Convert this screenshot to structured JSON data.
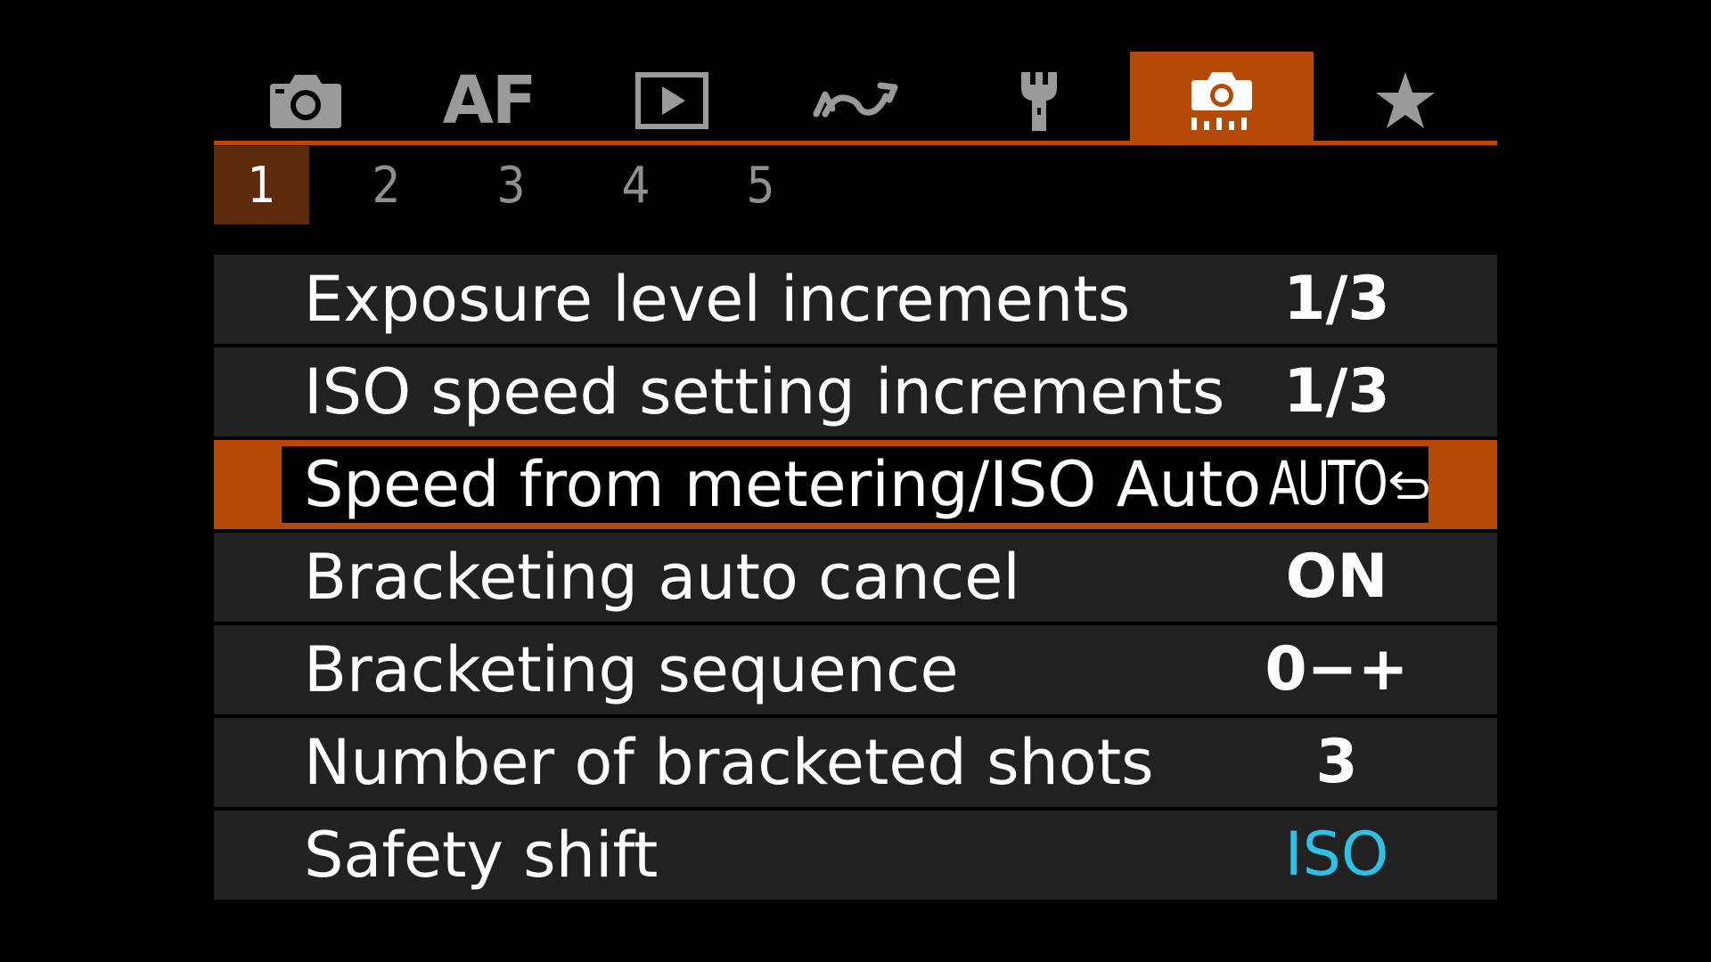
{
  "colors": {
    "accent": "#b44a06",
    "icon_gray": "#9a9a9a",
    "row_bg": "#212121",
    "value_blue": "#2cc2e8"
  },
  "tabs": [
    {
      "icon": "camera-icon",
      "active": false
    },
    {
      "label": "AF",
      "active": false
    },
    {
      "icon": "playback-icon",
      "active": false
    },
    {
      "icon": "wireless-icon",
      "active": false
    },
    {
      "icon": "wrench-icon",
      "active": false
    },
    {
      "icon": "custom-functions-icon",
      "active": true
    },
    {
      "icon": "star-icon",
      "active": false
    }
  ],
  "subtabs": [
    {
      "label": "1",
      "active": true
    },
    {
      "label": "2",
      "active": false
    },
    {
      "label": "3",
      "active": false
    },
    {
      "label": "4",
      "active": false
    },
    {
      "label": "5",
      "active": false
    }
  ],
  "menu": {
    "items": [
      {
        "label": "Exposure level increments",
        "value": "1/3"
      },
      {
        "label": "ISO speed setting increments",
        "value": "1/3"
      },
      {
        "label": "Speed from metering/ISO Auto",
        "value": "AUTO",
        "value_icon": "return-arrow-icon",
        "selected": true
      },
      {
        "label": "Bracketing auto cancel",
        "value": "ON"
      },
      {
        "label": "Bracketing sequence",
        "value": "0−+"
      },
      {
        "label": "Number of bracketed shots",
        "value": "3"
      },
      {
        "label": "Safety shift",
        "value": "ISO",
        "value_color": "#2cc2e8"
      }
    ]
  }
}
